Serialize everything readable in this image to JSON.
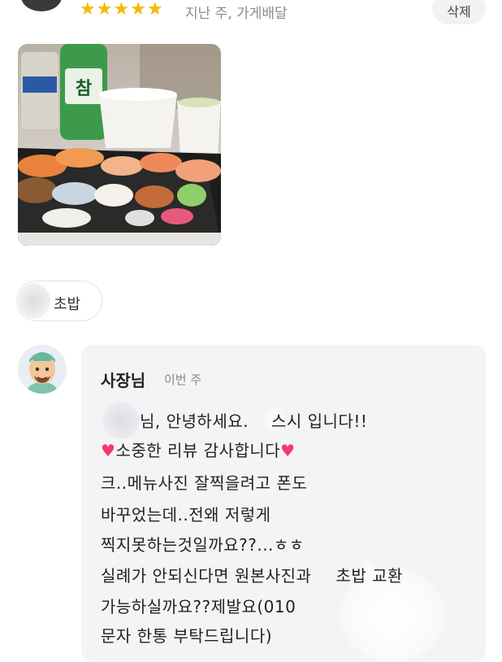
{
  "review": {
    "rating": 5,
    "stars": [
      "★",
      "★",
      "★",
      "★",
      "★"
    ],
    "meta": "지난 주, 가게배달",
    "delete_label": "삭제"
  },
  "menu_tag": {
    "label": "초밥"
  },
  "reply": {
    "owner_name": "사장님",
    "time": "이번 주",
    "lines": {
      "l1": "님, 안녕하세요.",
      "l1b": "스시 입니다!!",
      "l2": "소중한 리뷰 감사합니다",
      "l3": "크..메뉴사진 잘찍을려고 폰도",
      "l4": "바꾸었는데..전왜 저렇게",
      "l5": "찍지못하는것일까요??...ㅎㅎ",
      "l6": "실례가 안되신다면 원본사진과",
      "l6b": "초밥 교환",
      "l7": "가능하실까요??제발요(010",
      "l8": "문자 한통 부탁드립니다)"
    }
  },
  "colors": {
    "star": "#f6b800",
    "heart": "#f23a6b",
    "reply_bg": "#f4f4f7"
  }
}
